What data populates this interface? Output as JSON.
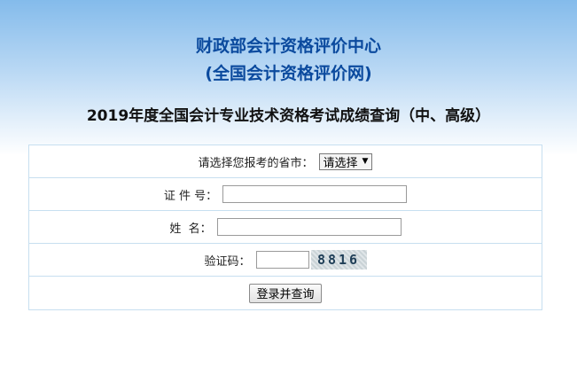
{
  "header": {
    "org_name": "财政部会计资格评价中心",
    "org_sub": "(全国会计资格评价网)",
    "exam_title": "2019年度全国会计专业技术资格考试成绩查询（中、高级）"
  },
  "form": {
    "province_label": "请选择您报考的省市：",
    "province_selected": "请选择",
    "id_label": "证 件 号：",
    "id_value": "",
    "name_label": "姓  名：",
    "name_value": "",
    "code_label": "验证码：",
    "code_value": "",
    "captcha_text": "8816",
    "submit_label": "登录并查询"
  }
}
